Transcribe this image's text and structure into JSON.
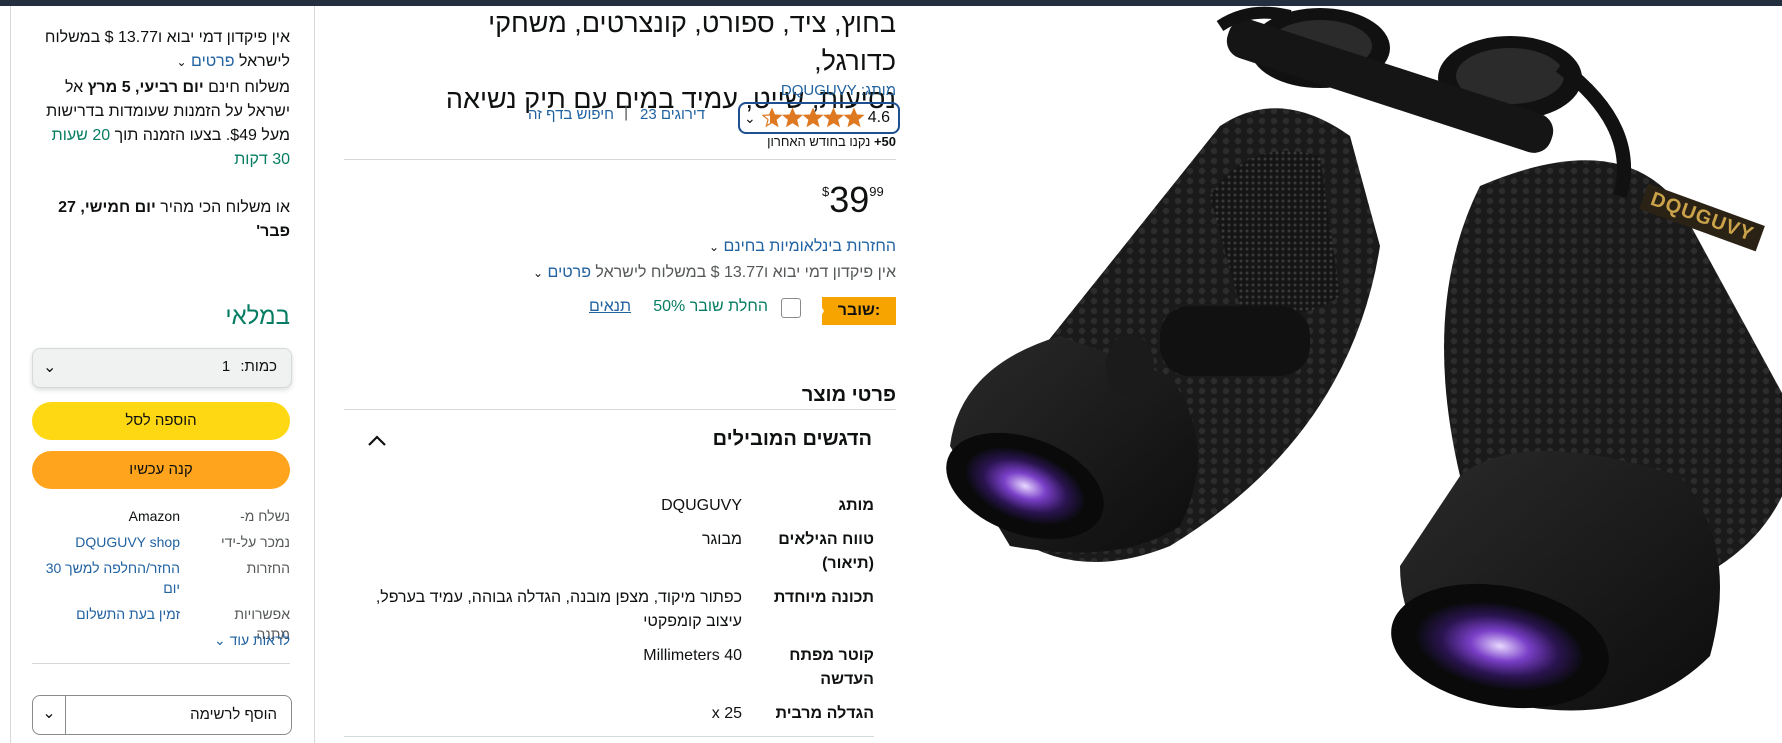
{
  "product": {
    "title_line1": "בחוץ, ציד, ספורט, קונצרטים, משחקי כדורגל,",
    "title_line2": "נסיעות, שייט, עמיד במים עם תיק נשיאה",
    "brand_prefix": "מותג:",
    "brand_name": "DQUGUVY",
    "rating_value": "4.6",
    "rating_stars": 4.6,
    "ratings_count": "23 דירוגים",
    "search_page": "חיפוש בדף זה",
    "bought_bold": "50+",
    "bought_rest": "נקנו בחודש האחרון",
    "price_symbol": "$",
    "price_whole": "39",
    "price_fraction": "99",
    "returns_label": "החזרות בינלאומיות בחינם",
    "import_text": "אין פיקדון דמי יבוא ו13.77 $ במשלוח לישראל",
    "import_details": "פרטים",
    "coupon_badge": "שובר:",
    "coupon_apply": "החלת שובר 50%",
    "coupon_terms": "תנאים",
    "product_details_heading": "פרטי מוצר",
    "highlights_heading": "הדגשים המובילים",
    "image_brand_text": "DQUGUVY",
    "specs": [
      {
        "label": "מותג",
        "value": "DQUGUVY"
      },
      {
        "label_line1": "טווח הגילאים",
        "label_line2": "(תיאור)",
        "value": "מבוגר"
      },
      {
        "label": "תכונה מיוחדת",
        "value_line1": "כפתור מיקוד, מצפן מובנה, הגדלה גבוהה, עמיד בערפל,",
        "value_line2": "עיצוב קומפקטי"
      },
      {
        "label_line1": "קוטר מפתח",
        "label_line2": "העדשה",
        "value": "40 Millimeters"
      },
      {
        "label": "הגדלה מרבית",
        "value": "25 x"
      }
    ]
  },
  "buybox": {
    "import_line1": "אין פיקדון דמי יבוא ו13.77 $ במשלוח",
    "import_line2_text": "לישראל",
    "import_line2_link": "פרטים",
    "delivery_pre": "משלוח חינם",
    "delivery_date": "יום רביעי, 5 מרץ",
    "delivery_post": "אל",
    "delivery_line2": "ישראל על הזמנות שעומדות בדרישות",
    "delivery_line3_pre": "מעל $49. בצעו הזמנה תוך",
    "delivery_countdown1": "20 שעות",
    "delivery_countdown2": "30 דקות",
    "fastest_pre": "או משלוח הכי מהיר",
    "fastest_date1": "יום חמישי, 27",
    "fastest_date2": "פבר'",
    "stock": "במלאי",
    "qty_label": "כמות:",
    "qty_value": "1",
    "add_to_cart": "הוספה לסל",
    "buy_now": "קנה עכשיו",
    "rows": [
      {
        "label": "נשלח מ-",
        "value": "Amazon",
        "link": false
      },
      {
        "label": "נמכר על-ידי",
        "value": "DQUGUVY shop",
        "link": true
      },
      {
        "label": "החזרות",
        "value_line1": "החזר/החלפה למשך 30",
        "value_line2": "יום",
        "link": true
      },
      {
        "label": "אפשרויות מתנה",
        "value": "זמין בעת התשלום",
        "link": true
      }
    ],
    "see_more": "לראות עוד",
    "add_to_list": "הוסף לרשימה"
  },
  "colors": {
    "accent_link": "#2162a1",
    "cart_button": "#ffd814",
    "buy_button": "#ffa41c",
    "in_stock": "#067d62",
    "star": "#de7921",
    "coupon_badge": "#f7a300"
  }
}
